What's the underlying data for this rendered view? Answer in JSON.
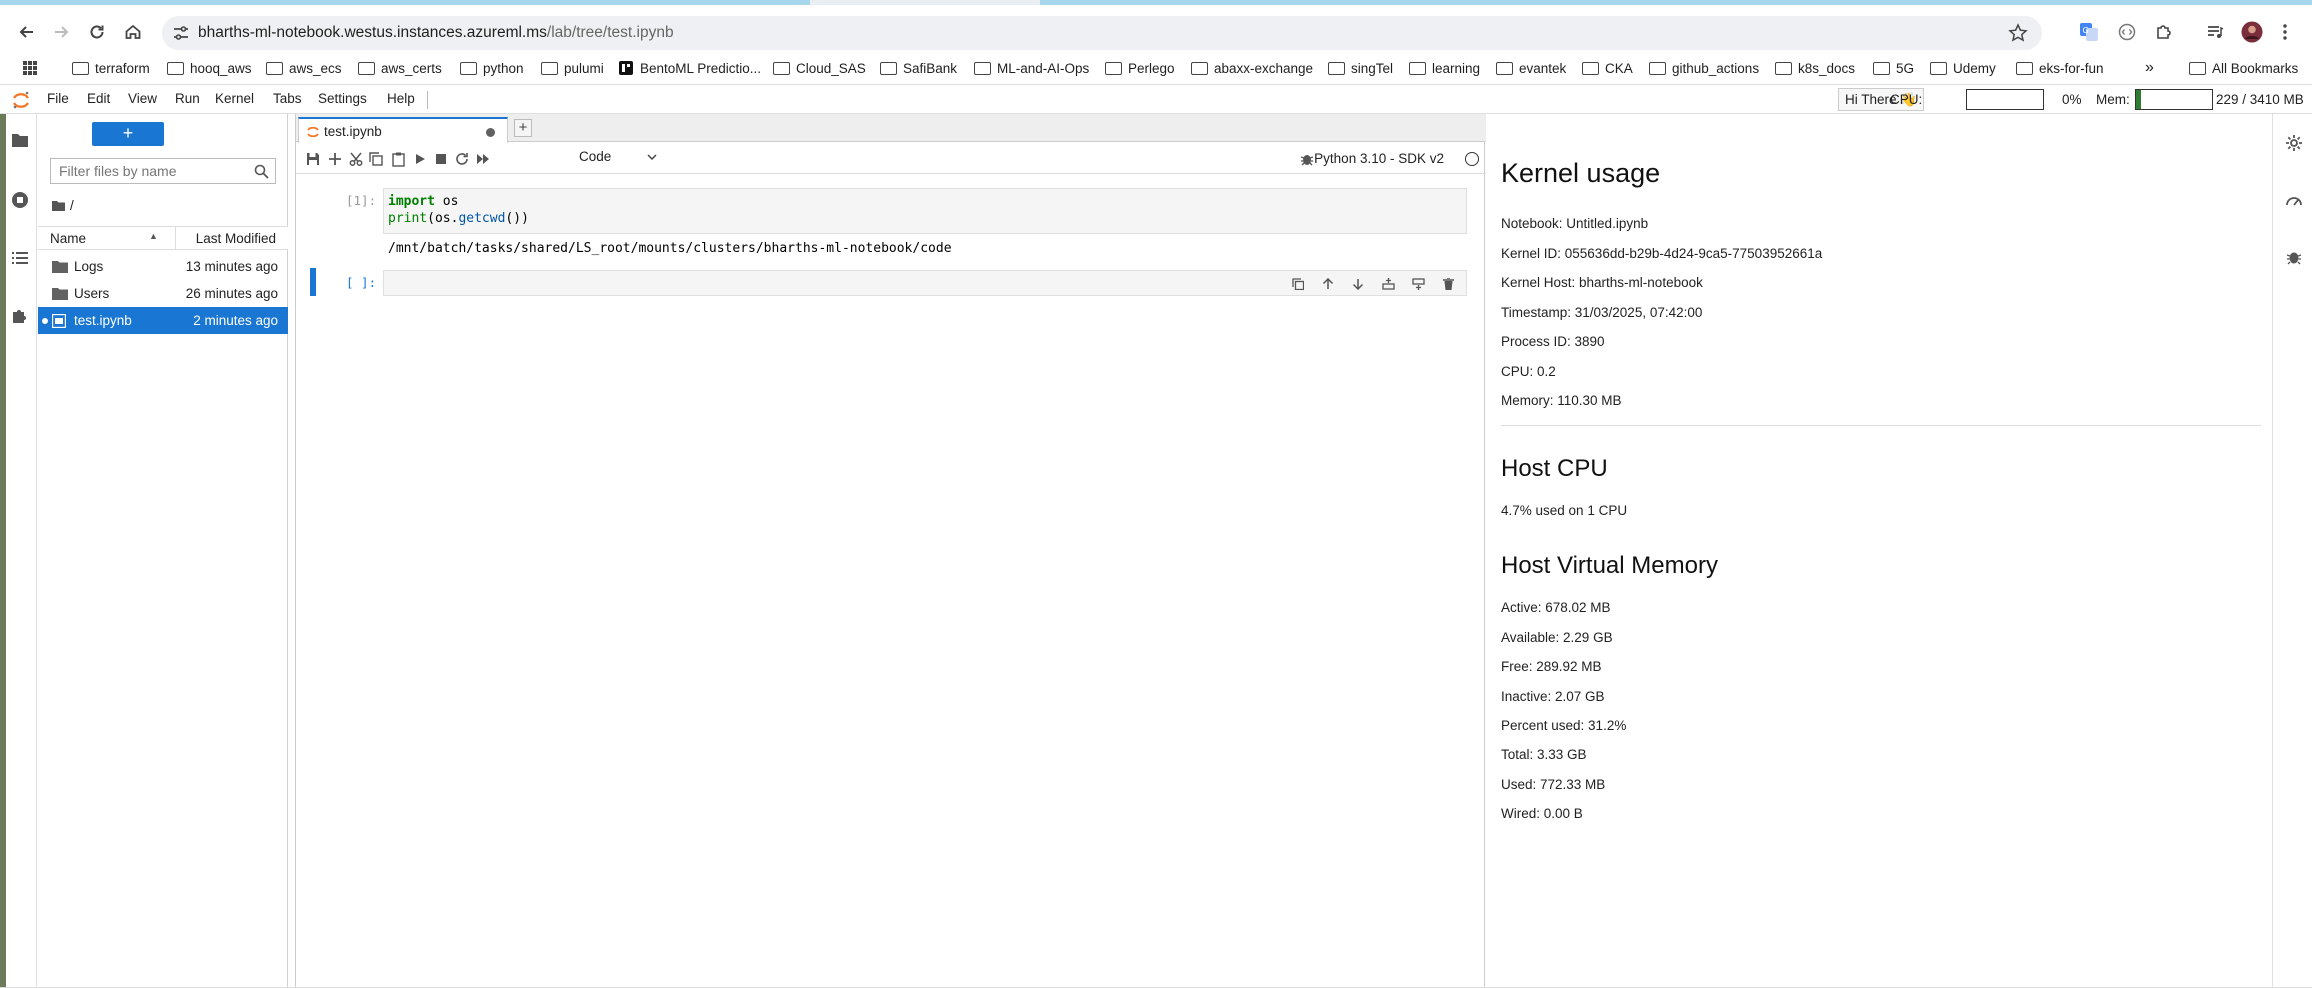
{
  "browser": {
    "url_host": "bharths-ml-notebook.westus.instances.azureml.ms",
    "url_path": "/lab/tree/test.ipynb"
  },
  "bookmarks": {
    "items": [
      "terraform",
      "hooq_aws",
      "aws_ecs",
      "aws_certs",
      "python",
      "pulumi",
      "BentoML Predictio...",
      "Cloud_SAS",
      "SafiBank",
      "ML-and-AI-Ops",
      "Perlego",
      "abaxx-exchange",
      "singTel",
      "learning",
      "evantek",
      "CKA",
      "github_actions",
      "k8s_docs",
      "5G",
      "Udemy",
      "eks-for-fun"
    ],
    "more": "»",
    "all": "All Bookmarks"
  },
  "jupyter": {
    "menu": [
      "File",
      "Edit",
      "View",
      "Run",
      "Kernel",
      "Tabs",
      "Settings",
      "Help"
    ],
    "greeting": "Hi There 👋",
    "cpu_label": "CPU:",
    "cpu_value": "0%",
    "cpu_fraction": 0.0,
    "mem_label": "Mem:",
    "mem_value": "229 / 3410 MB",
    "mem_fraction": 0.067
  },
  "filebrowser": {
    "new_label": "+",
    "filter_placeholder": "Filter files by name",
    "path": "/",
    "col_name": "Name",
    "col_modified": "Last Modified",
    "files": [
      {
        "name": "Logs",
        "modified": "13 minutes ago"
      },
      {
        "name": "Users",
        "modified": "26 minutes ago"
      },
      {
        "name": "test.ipynb",
        "modified": "2 minutes ago"
      }
    ]
  },
  "notebook": {
    "tab_title": "test.ipynb",
    "cell_type": "Code",
    "kernel": "Python 3.10 - SDK v2",
    "cell1_prompt": "[1]:",
    "cell1_line1_kw": "import",
    "cell1_line1_rest": " os",
    "cell1_line2_bi": "print",
    "cell1_line2_a": "(os.",
    "cell1_line2_fn": "getcwd",
    "cell1_line2_b": "())",
    "cell1_output": "/mnt/batch/tasks/shared/LS_root/mounts/clusters/bharths-ml-notebook/code",
    "cell2_prompt": "[ ]:"
  },
  "kernel_usage": {
    "title": "Kernel usage",
    "notebook": "Notebook: Untitled.ipynb",
    "kernel_id": "Kernel ID: 055636dd-b29b-4d24-9ca5-77503952661a",
    "kernel_host": "Kernel Host: bharths-ml-notebook",
    "timestamp": "Timestamp: 31/03/2025, 07:42:00",
    "process_id": "Process ID: 3890",
    "cpu": "CPU: 0.2",
    "memory": "Memory: 110.30 MB",
    "host_cpu_title": "Host CPU",
    "host_cpu": "4.7% used on 1 CPU",
    "host_vm_title": "Host Virtual Memory",
    "active": "Active: 678.02 MB",
    "available": "Available: 2.29 GB",
    "free": "Free: 289.92 MB",
    "inactive": "Inactive: 2.07 GB",
    "percent_used": "Percent used: 31.2%",
    "total": "Total: 3.33 GB",
    "used": "Used: 772.33 MB",
    "wired": "Wired: 0.00 B"
  },
  "colors": {
    "accent": "#1976d2",
    "jupyter_orange": "#f37726",
    "mem_bar": "#2e7d32"
  }
}
